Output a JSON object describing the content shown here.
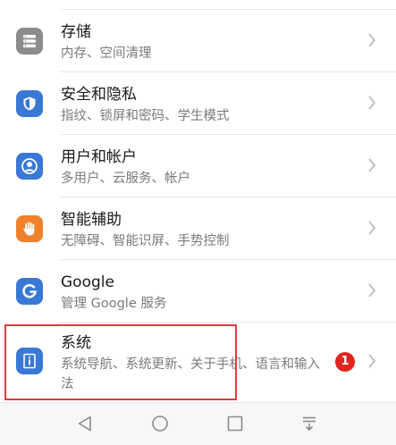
{
  "settings": {
    "items": [
      {
        "title": "存储",
        "subtitle": "内存、空间清理",
        "icon": "storage-icon",
        "color": "#8c8c8c"
      },
      {
        "title": "安全和隐私",
        "subtitle": "指纹、锁屏和密码、学生模式",
        "icon": "shield-icon",
        "color": "#3a78d6"
      },
      {
        "title": "用户和帐户",
        "subtitle": "多用户、云服务、帐户",
        "icon": "user-icon",
        "color": "#3a78d6"
      },
      {
        "title": "智能辅助",
        "subtitle": "无障碍、智能识屏、手势控制",
        "icon": "hand-icon",
        "color": "#f0812a"
      },
      {
        "title": "Google",
        "subtitle": "管理 Google 服务",
        "icon": "google-icon",
        "color": "#3a78d6"
      },
      {
        "title": "系统",
        "subtitle": "系统导航、系统更新、关于手机、语言和输入法",
        "icon": "system-info-icon",
        "color": "#3a78d6"
      }
    ],
    "system_badge": "1"
  },
  "navbar": {
    "buttons": [
      "back-icon",
      "home-icon",
      "recents-icon",
      "notification-pull-icon"
    ]
  }
}
